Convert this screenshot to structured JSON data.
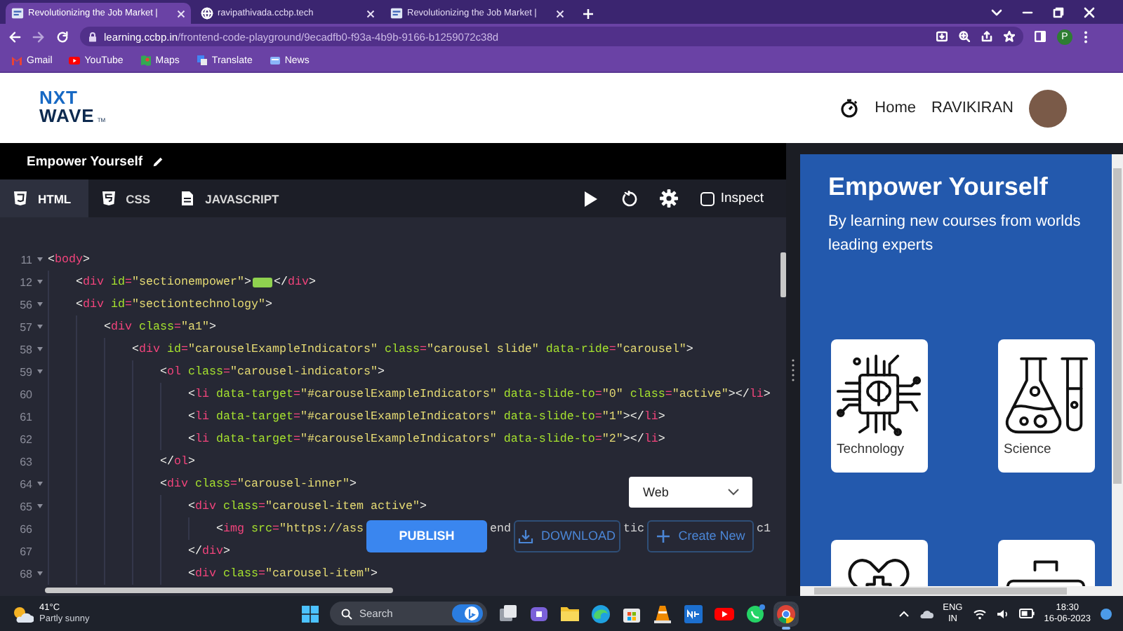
{
  "browser": {
    "tabs": [
      {
        "title": "Revolutionizing the Job Market |",
        "kind": "page",
        "selected": true
      },
      {
        "title": "ravipathivada.ccbp.tech",
        "kind": "site",
        "selected": false
      },
      {
        "title": "Revolutionizing the Job Market |",
        "kind": "page",
        "selected": false
      }
    ],
    "url_host": "learning.ccbp.in",
    "url_path": "/frontend-code-playground/9ecadfb0-f93a-4b9b-9166-b1259072c38d",
    "profile_initial": "P",
    "bookmarks": [
      {
        "label": "Gmail",
        "kind": "gmail"
      },
      {
        "label": "YouTube",
        "kind": "youtube"
      },
      {
        "label": "Maps",
        "kind": "maps"
      },
      {
        "label": "Translate",
        "kind": "translate"
      },
      {
        "label": "News",
        "kind": "news"
      }
    ]
  },
  "site_header": {
    "logo": {
      "top": "NXT",
      "bottom": "WAVE",
      "mark": "TM"
    },
    "nav": "Home",
    "user": "RAVIKIRAN"
  },
  "project": {
    "title": "Empower Yourself"
  },
  "editor": {
    "tabs": [
      {
        "label": "HTML",
        "kind": "html",
        "selected": true
      },
      {
        "label": "CSS",
        "kind": "css",
        "selected": false
      },
      {
        "label": "JAVASCRIPT",
        "kind": "js",
        "selected": false
      }
    ],
    "inspect": {
      "label": "Inspect",
      "checked": false
    },
    "lines": [
      {
        "number": "11",
        "fold": true,
        "parts": [
          {
            "kind": "code",
            "text": "<body>"
          }
        ],
        "children": [
          {
            "number": "12",
            "fold": true,
            "parts": [
              {
                "kind": "code",
                "text": "<div id=\"sectionempower\">"
              },
              {
                "kind": "folded"
              },
              {
                "kind": "code",
                "text": "</div>"
              }
            ]
          },
          {
            "number": "56",
            "fold": true,
            "parts": [
              {
                "kind": "code",
                "text": "<div id=\"sectiontechnology\">"
              }
            ],
            "children": [
              {
                "number": "57",
                "fold": true,
                "parts": [
                  {
                    "kind": "code",
                    "text": "<div class=\"a1\">"
                  }
                ],
                "children": [
                  {
                    "number": "58",
                    "fold": true,
                    "parts": [
                      {
                        "kind": "code",
                        "text": "<div id=\"carouselExampleIndicators\" class=\"carousel slide\" data-ride=\"carousel\">"
                      }
                    ],
                    "children": [
                      {
                        "number": "59",
                        "fold": true,
                        "parts": [
                          {
                            "kind": "code",
                            "text": "<ol class=\"carousel-indicators\">"
                          }
                        ],
                        "children": [
                          {
                            "number": "60",
                            "fold": false,
                            "parts": [
                              {
                                "kind": "code",
                                "text": "<li data-target=\"#carouselExampleIndicators\" data-slide-to=\"0\" class=\"active\"></li>"
                              }
                            ]
                          },
                          {
                            "number": "61",
                            "fold": false,
                            "parts": [
                              {
                                "kind": "code",
                                "text": "<li data-target=\"#carouselExampleIndicators\" data-slide-to=\"1\"></li>"
                              }
                            ]
                          },
                          {
                            "number": "62",
                            "fold": false,
                            "parts": [
                              {
                                "kind": "code",
                                "text": "<li data-target=\"#carouselExampleIndicators\" data-slide-to=\"2\"></li>"
                              }
                            ]
                          }
                        ]
                      },
                      {
                        "number": "63",
                        "fold": false,
                        "parts": [
                          {
                            "kind": "code",
                            "text": "</ol>"
                          }
                        ]
                      },
                      {
                        "number": "64",
                        "fold": true,
                        "parts": [
                          {
                            "kind": "code",
                            "text": "<div class=\"carousel-inner\">"
                          }
                        ],
                        "children": [
                          {
                            "number": "65",
                            "fold": true,
                            "parts": [
                              {
                                "kind": "code",
                                "text": "<div class=\"carousel-item active\">"
                              }
                            ],
                            "children": [
                              {
                                "number": "66",
                                "fold": false,
                                "parts": [
                                  {
                                    "kind": "code",
                                    "text": "<img src=\"https://ass"
                                  },
                                  {
                                    "kind": "publish",
                                    "label": "PUBLISH"
                                  },
                                  {
                                    "kind": "code",
                                    "text": "end"
                                  },
                                  {
                                    "kind": "download",
                                    "label": "DOWNLOAD"
                                  },
                                  {
                                    "kind": "code",
                                    "text": "tic"
                                  },
                                  {
                                    "kind": "create",
                                    "label": "Create New"
                                  },
                                  {
                                    "kind": "code",
                                    "text": "c1"
                                  }
                                ]
                              }
                            ]
                          },
                          {
                            "number": "67",
                            "fold": false,
                            "parts": [
                              {
                                "kind": "code",
                                "text": "</div>"
                              }
                            ]
                          },
                          {
                            "number": "68",
                            "fold": true,
                            "parts": [
                              {
                                "kind": "code",
                                "text": "<div class=\"carousel-item\">"
                              }
                            ]
                          }
                        ]
                      }
                    ]
                  }
                ]
              }
            ]
          }
        ]
      }
    ],
    "format_select": {
      "value": "Web"
    }
  },
  "preview": {
    "title": "Empower Yourself",
    "subtitle": "By learning new courses from worlds leading experts",
    "cards": [
      {
        "label": "Technology",
        "kind": "technology"
      },
      {
        "label": "Science",
        "kind": "science"
      },
      {
        "kind": "health"
      },
      {
        "kind": "business"
      }
    ]
  },
  "taskbar": {
    "weather": {
      "temp": "41°C",
      "condition": "Partly sunny"
    },
    "search": {
      "placeholder": "Search"
    },
    "apps": [
      {
        "kind": "taskview",
        "active": false
      },
      {
        "kind": "meet",
        "active": false
      },
      {
        "kind": "folder",
        "active": false
      },
      {
        "kind": "edge",
        "active": false
      },
      {
        "kind": "store",
        "active": false
      },
      {
        "kind": "vlc",
        "active": false
      },
      {
        "kind": "ndp",
        "active": false
      },
      {
        "kind": "youtube",
        "active": false
      },
      {
        "kind": "whatsapp",
        "active": false
      },
      {
        "kind": "chrome",
        "active": true
      }
    ],
    "language": {
      "top": "ENG",
      "bottom": "IN"
    },
    "time": "18:30",
    "date": "16-06-2023"
  }
}
